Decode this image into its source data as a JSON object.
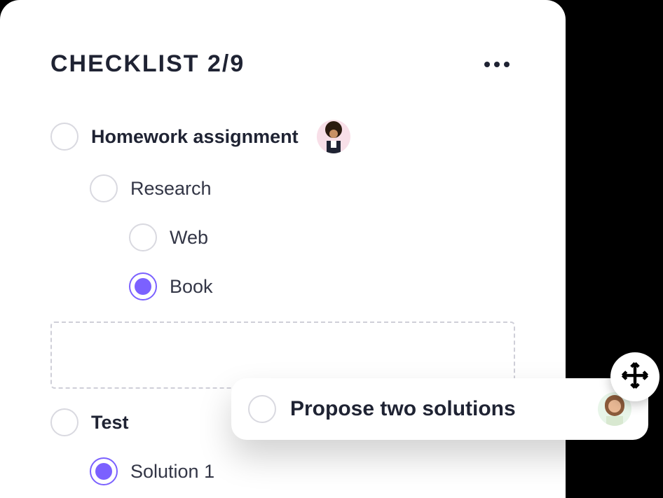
{
  "header": {
    "title": "CHECKLIST 2/9"
  },
  "items": {
    "homework": {
      "label": "Homework assignment"
    },
    "research": {
      "label": "Research"
    },
    "web": {
      "label": "Web"
    },
    "book": {
      "label": "Book"
    },
    "test": {
      "label": "Test"
    },
    "solution1": {
      "label": "Solution 1"
    }
  },
  "dragged": {
    "label": "Propose two solutions"
  },
  "avatars": {
    "a1": "avatar-person-1",
    "a2": "avatar-person-2"
  },
  "colors": {
    "accent": "#7b61ff"
  },
  "progress": {
    "completed": 2,
    "total": 9
  }
}
